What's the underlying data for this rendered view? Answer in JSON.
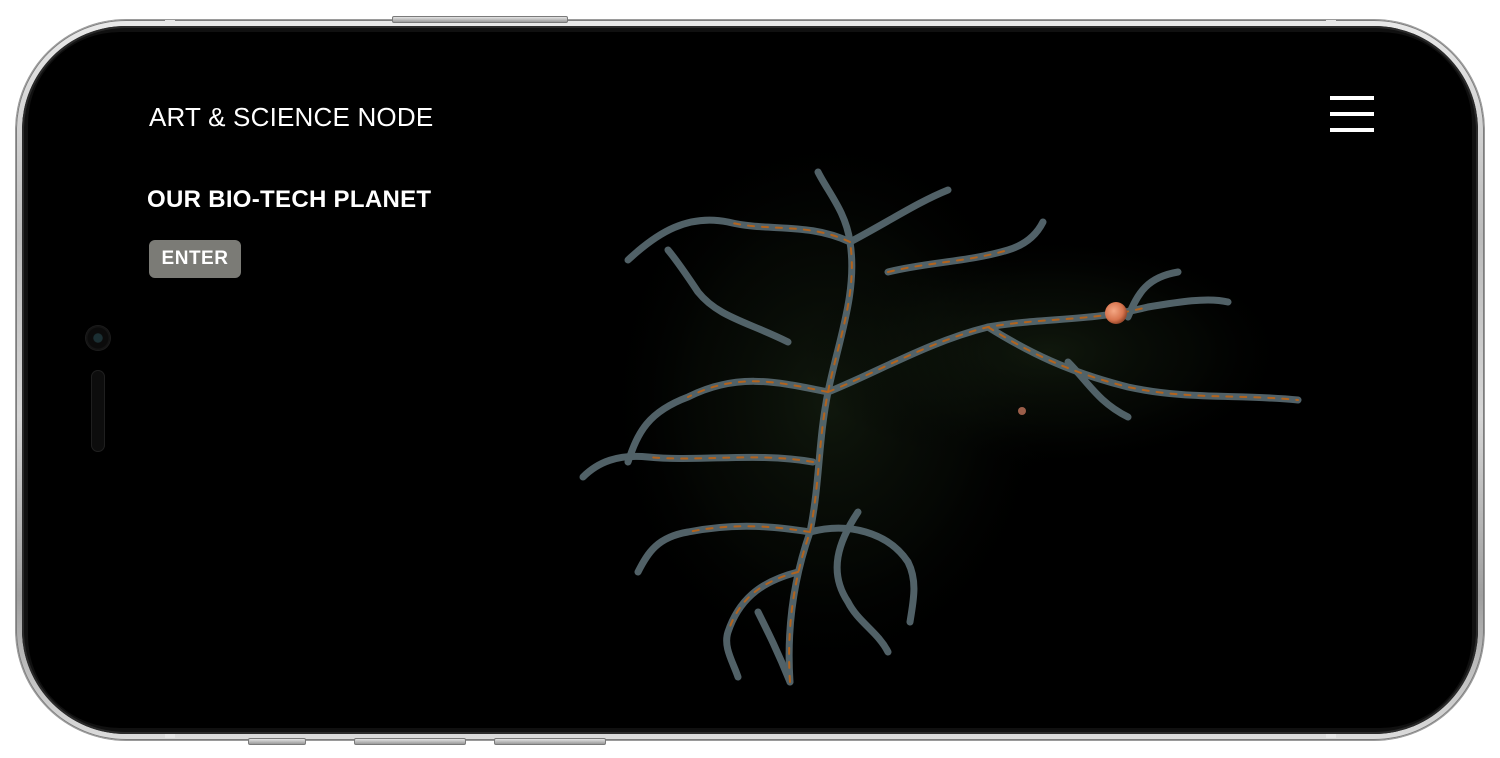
{
  "header": {
    "site_title": "ART & SCIENCE NODE",
    "menu_icon": "hamburger-menu-icon"
  },
  "hero": {
    "heading": "OUR BIO-TECH PLANET",
    "enter_label": "ENTER",
    "artwork": "branching-bio-tech-tree-illustration"
  },
  "colors": {
    "background": "#000000",
    "text": "#ffffff",
    "button_background": "#7b7b76",
    "branch_stroke": "#5a6c73",
    "branch_highlight": "#b8641a",
    "node_orb": "#d8754f"
  }
}
